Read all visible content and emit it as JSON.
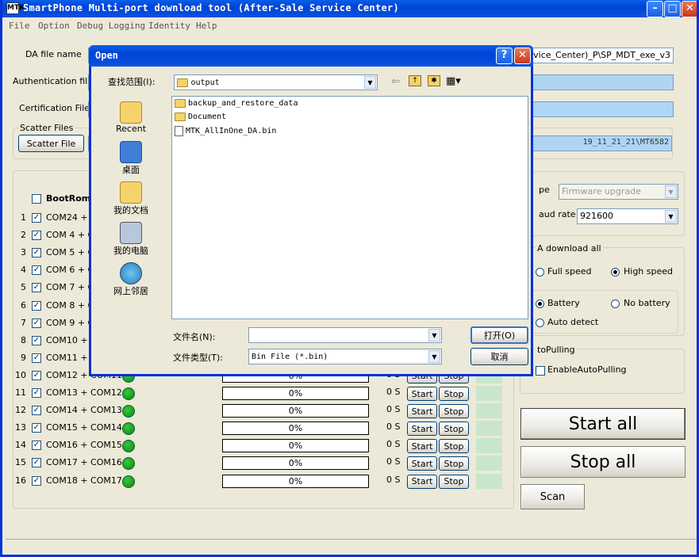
{
  "window": {
    "title": "SmartPhone Multi-port download tool (After-Sale Service Center)",
    "icon_text": "MTK"
  },
  "menu": [
    "File",
    "Option",
    "Debug Logging",
    "Identity",
    "Help"
  ],
  "top": {
    "da_label": "DA file name",
    "da_value": "rvice_Center)_P\\SP_MDT_exe_v3",
    "auth_label": "Authentication file",
    "cert_label": "Certification File",
    "scatter_group": "Scatter Files",
    "scatter_button": "Scatter File",
    "scatter_value": "19_11_21_21\\MT6582"
  },
  "table": {
    "header": "BootRom+",
    "rows": [
      {
        "num": "1",
        "name": "COM24 + CO"
      },
      {
        "num": "2",
        "name": "COM 4 + CO"
      },
      {
        "num": "3",
        "name": "COM 5 + CO"
      },
      {
        "num": "4",
        "name": "COM 6 + CO"
      },
      {
        "num": "5",
        "name": "COM 7 + CO"
      },
      {
        "num": "6",
        "name": "COM 8 + CO"
      },
      {
        "num": "7",
        "name": "COM 9 + CO"
      },
      {
        "num": "8",
        "name": "COM10 + CO"
      },
      {
        "num": "9",
        "name": "COM11 + CO"
      },
      {
        "num": "10",
        "name": "COM12 + COM11",
        "progress": "0%",
        "time": "0 S"
      },
      {
        "num": "11",
        "name": "COM13 + COM12",
        "progress": "0%",
        "time": "0 S"
      },
      {
        "num": "12",
        "name": "COM14 + COM13",
        "progress": "0%",
        "time": "0 S"
      },
      {
        "num": "13",
        "name": "COM15 + COM14",
        "progress": "0%",
        "time": "0 S"
      },
      {
        "num": "14",
        "name": "COM16 + COM15",
        "progress": "0%",
        "time": "0 S"
      },
      {
        "num": "15",
        "name": "COM17 + COM16",
        "progress": "0%",
        "time": "0 S"
      },
      {
        "num": "16",
        "name": "COM18 + COM17",
        "progress": "0%",
        "time": "0 S"
      }
    ],
    "start_label": "Start",
    "stop_label": "Stop"
  },
  "right": {
    "type_label": "pe",
    "type_value": "Firmware upgrade",
    "baud_label": "aud rate",
    "baud_value": "921600",
    "dl_group": "A download all",
    "full_speed": "Full speed",
    "high_speed": "High speed",
    "battery": "Battery",
    "no_battery": "No battery",
    "auto_detect": "Auto detect",
    "autopull_group": "toPulling",
    "enable_autopull": "EnableAutoPulling",
    "start_all": "Start all",
    "stop_all": "Stop all",
    "scan": "Scan"
  },
  "dialog": {
    "title": "Open",
    "lookin_label": "查找范围(I):",
    "lookin_value": "output",
    "places": [
      "Recent",
      "桌面",
      "我的文档",
      "我的电脑",
      "网上邻居"
    ],
    "files": [
      {
        "name": "backup_and_restore_data",
        "kind": "folder"
      },
      {
        "name": "Document",
        "kind": "folder"
      },
      {
        "name": "MTK_AllInOne_DA.bin",
        "kind": "file"
      }
    ],
    "filename_label": "文件名(N):",
    "filename_value": "",
    "filetype_label": "文件类型(T):",
    "filetype_value": "Bin File (*.bin)",
    "open_button": "打开(O)",
    "cancel_button": "取消"
  }
}
